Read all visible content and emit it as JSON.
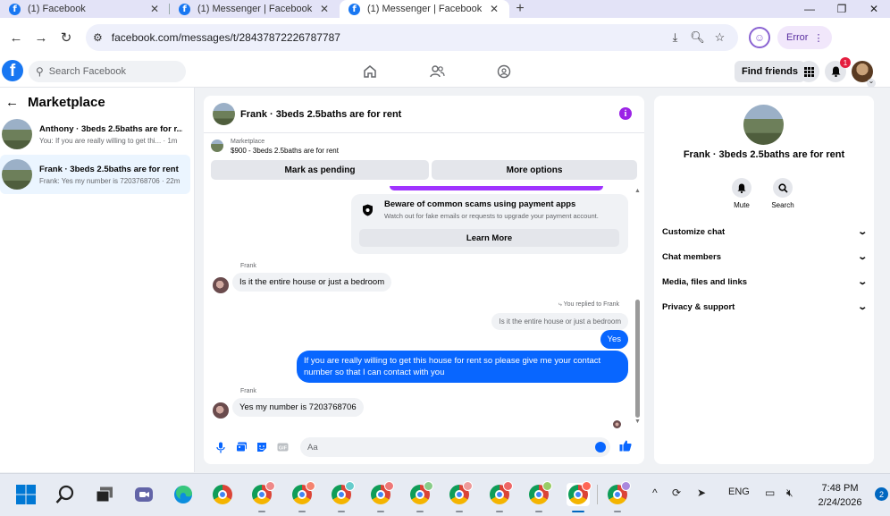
{
  "browser": {
    "tabs": [
      {
        "title": "(1) Facebook",
        "active": false
      },
      {
        "title": "(1) Messenger | Facebook",
        "active": false
      },
      {
        "title": "(1) Messenger | Facebook",
        "active": true
      }
    ],
    "new_tab_icon": "plus-icon",
    "url": "facebook.com/messages/t/28437872226787787",
    "profile_label": "Error",
    "accent": "#1877f2"
  },
  "fb": {
    "search_placeholder": "Search Facebook",
    "find_friends": "Find friends",
    "notification_count": "1",
    "nav_icons": [
      "home-icon",
      "friends-icon",
      "groups-icon"
    ]
  },
  "sidebar": {
    "title": "Marketplace",
    "conversations": [
      {
        "name": "Anthony · 3beds 2.5baths are for r...",
        "preview": "You: If you are really willing to get thi... · 1m",
        "selected": false
      },
      {
        "name": "Frank · 3beds 2.5baths are for rent",
        "preview": "Frank: Yes my number is 7203768706 · 22m",
        "selected": true
      }
    ]
  },
  "chat": {
    "title": "Frank · 3beds 2.5baths are for rent",
    "marketplace_label": "Marketplace",
    "listing": "$900 - 3beds 2.5baths are for rent",
    "mark_pending": "Mark as pending",
    "more_options": "More options",
    "warning": {
      "title": "Beware of common scams using payment apps",
      "subtitle": "Watch out for fake emails or requests to upgrade your payment account.",
      "button": "Learn More"
    },
    "messages": [
      {
        "from": "Frank",
        "text": "Is it the entire house or just a bedroom"
      },
      {
        "replied_label": "You replied to Frank",
        "quoted": "Is it the entire house or just a bedroom",
        "text": "Yes"
      },
      {
        "text": "If you are really willing to get this house for rent so please give me your contact number so that I  can contact with you"
      },
      {
        "from": "Frank",
        "text": "Yes my number is 7203768706"
      }
    ],
    "composer_placeholder": "Aa",
    "outgoing_color": "#0866ff"
  },
  "details": {
    "name": "Frank · 3beds 2.5baths are for rent",
    "actions": [
      {
        "label": "Mute",
        "icon": "bell-icon"
      },
      {
        "label": "Search",
        "icon": "search-icon"
      }
    ],
    "sections": [
      "Customize chat",
      "Chat members",
      "Media, files and links",
      "Privacy & support"
    ]
  },
  "taskbar": {
    "language": "ENG",
    "time": "7:48 PM",
    "date": "2/24/2026",
    "notification_count": "2"
  }
}
